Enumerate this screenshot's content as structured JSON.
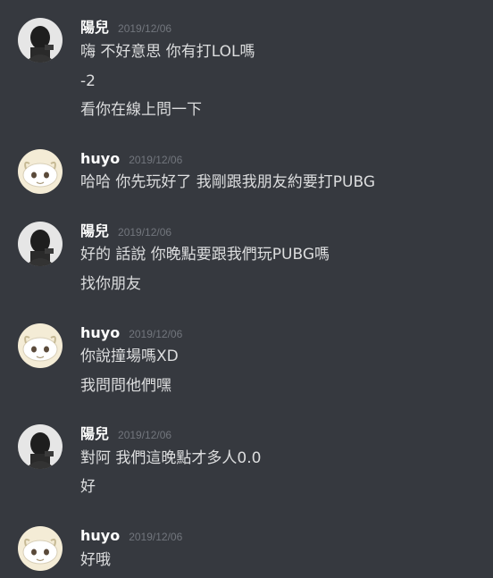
{
  "groups": [
    {
      "author": "陽兒",
      "timestamp": "2019/12/06",
      "avatar_icon": "user-photo-avatar",
      "lines": [
        "嗨 不好意思  你有打LOL嗎",
        "-2",
        "看你在線上問一下"
      ]
    },
    {
      "author": "huyo",
      "timestamp": "2019/12/06",
      "avatar_icon": "animal-skull-avatar",
      "lines": [
        "哈哈 你先玩好了 我剛跟我朋友約要打PUBG"
      ]
    },
    {
      "author": "陽兒",
      "timestamp": "2019/12/06",
      "avatar_icon": "user-photo-avatar",
      "lines": [
        "好的  話說 你晚點要跟我們玩PUBG嗎",
        "找你朋友"
      ]
    },
    {
      "author": "huyo",
      "timestamp": "2019/12/06",
      "avatar_icon": "animal-skull-avatar",
      "lines": [
        "你說撞場嗎XD",
        "我問問他們嘿"
      ]
    },
    {
      "author": "陽兒",
      "timestamp": "2019/12/06",
      "avatar_icon": "user-photo-avatar",
      "lines": [
        "對阿 我們這晚點才多人0.0",
        "好"
      ]
    },
    {
      "author": "huyo",
      "timestamp": "2019/12/06",
      "avatar_icon": "animal-skull-avatar",
      "lines": [
        "好哦"
      ]
    }
  ],
  "colors": {
    "background": "#36393f",
    "username": "#ffffff",
    "timestamp": "#72767d",
    "message_text": "#dcddde"
  }
}
